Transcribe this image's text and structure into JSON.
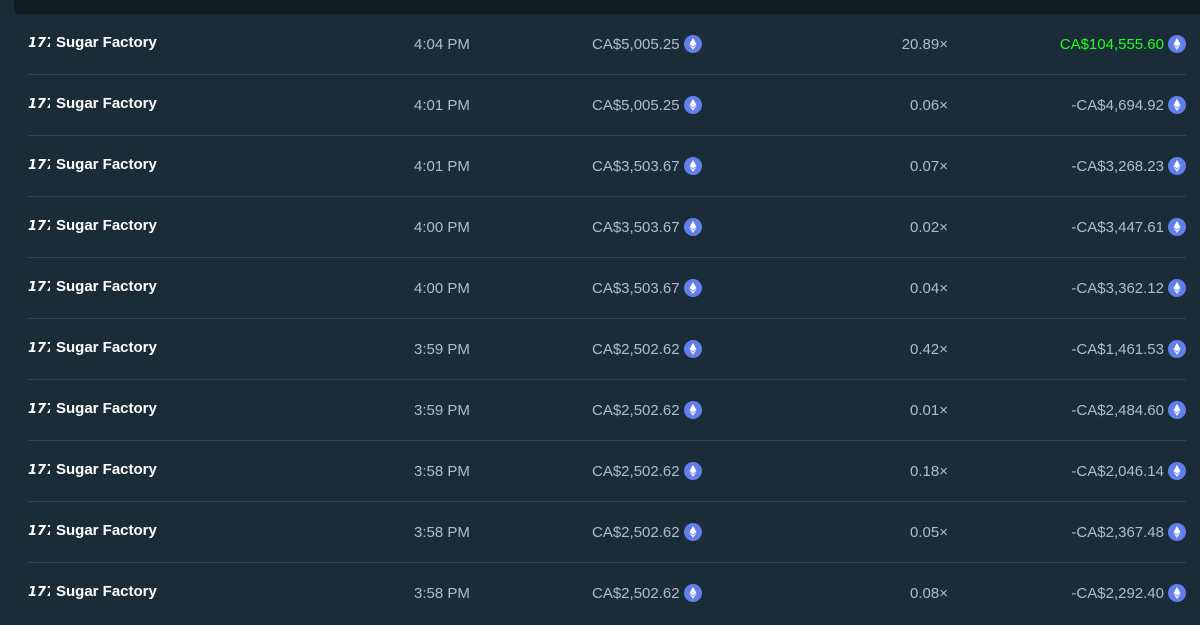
{
  "icons": {
    "game_logo": "sugar-factory-logo-icon",
    "currency": "ethereum-icon"
  },
  "colors": {
    "background": "#1a2c38",
    "divider": "#2f4553",
    "text_muted": "#b1bad3",
    "text_primary": "#ffffff",
    "win": "#1fff20",
    "eth_badge": "#627eea"
  },
  "rows": [
    {
      "game": "Sugar Factory",
      "time": "4:04 PM",
      "bet": "CA$5,005.25",
      "multiplier": "20.89×",
      "payout": "CA$104,555.60",
      "win": true
    },
    {
      "game": "Sugar Factory",
      "time": "4:01 PM",
      "bet": "CA$5,005.25",
      "multiplier": "0.06×",
      "payout": "-CA$4,694.92",
      "win": false
    },
    {
      "game": "Sugar Factory",
      "time": "4:01 PM",
      "bet": "CA$3,503.67",
      "multiplier": "0.07×",
      "payout": "-CA$3,268.23",
      "win": false
    },
    {
      "game": "Sugar Factory",
      "time": "4:00 PM",
      "bet": "CA$3,503.67",
      "multiplier": "0.02×",
      "payout": "-CA$3,447.61",
      "win": false
    },
    {
      "game": "Sugar Factory",
      "time": "4:00 PM",
      "bet": "CA$3,503.67",
      "multiplier": "0.04×",
      "payout": "-CA$3,362.12",
      "win": false
    },
    {
      "game": "Sugar Factory",
      "time": "3:59 PM",
      "bet": "CA$2,502.62",
      "multiplier": "0.42×",
      "payout": "-CA$1,461.53",
      "win": false
    },
    {
      "game": "Sugar Factory",
      "time": "3:59 PM",
      "bet": "CA$2,502.62",
      "multiplier": "0.01×",
      "payout": "-CA$2,484.60",
      "win": false
    },
    {
      "game": "Sugar Factory",
      "time": "3:58 PM",
      "bet": "CA$2,502.62",
      "multiplier": "0.18×",
      "payout": "-CA$2,046.14",
      "win": false
    },
    {
      "game": "Sugar Factory",
      "time": "3:58 PM",
      "bet": "CA$2,502.62",
      "multiplier": "0.05×",
      "payout": "-CA$2,367.48",
      "win": false
    },
    {
      "game": "Sugar Factory",
      "time": "3:58 PM",
      "bet": "CA$2,502.62",
      "multiplier": "0.08×",
      "payout": "-CA$2,292.40",
      "win": false
    }
  ]
}
